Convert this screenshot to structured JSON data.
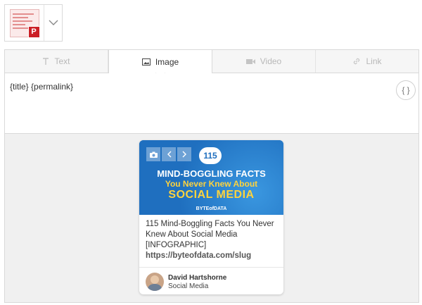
{
  "account": {
    "platform_badge": "P",
    "dropdown_icon": "chevron-down-icon"
  },
  "tabs": [
    {
      "label": "Text",
      "icon": "text-icon",
      "active": false
    },
    {
      "label": "Image",
      "icon": "image-icon",
      "active": true
    },
    {
      "label": "Video",
      "icon": "video-icon",
      "active": false
    },
    {
      "label": "Link",
      "icon": "link-icon",
      "active": false
    }
  ],
  "editor": {
    "message": "{title} {permalink}",
    "variables_button": "{ }"
  },
  "preview": {
    "image": {
      "badge": "115",
      "line1": "MIND-BOGGLING FACTS",
      "line2": "You Never Knew About",
      "line3": "SOCIAL MEDIA",
      "brand": "BYTEofDATA"
    },
    "title": "115 Mind-Boggling Facts You Never Knew About Social Media [INFOGRAPHIC]",
    "link": "https://byteofdata.com/slug",
    "author": "David Hartshorne",
    "board": "Social Media"
  },
  "colors": {
    "pinterest_red": "#cb2027",
    "image_blue": "#1f6fbf",
    "headline_yellow": "#ffd33d"
  }
}
